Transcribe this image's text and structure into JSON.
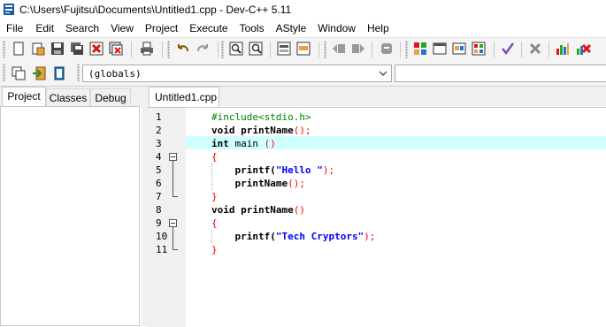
{
  "window": {
    "title": "C:\\Users\\Fujitsu\\Documents\\Untitled1.cpp - Dev-C++ 5.11"
  },
  "menu": [
    "File",
    "Edit",
    "Search",
    "View",
    "Project",
    "Execute",
    "Tools",
    "AStyle",
    "Window",
    "Help"
  ],
  "toolbar": {
    "icons": [
      "new-file-icon",
      "open-project-icon",
      "save-icon",
      "save-all-icon",
      "close-icon",
      "close-all-icon",
      "print-icon",
      "undo-icon",
      "redo-icon",
      "find-icon",
      "replace-icon",
      "goto-icon",
      "bookmark-icon",
      "indent-icon",
      "unindent-icon",
      "compile-icon",
      "run-icon",
      "compile-run-icon",
      "rebuild-icon",
      "debug-icon",
      "stop-icon",
      "profile-icon",
      "delete-profile-icon",
      "new-class-icon",
      "insert-icon",
      "toggle-icon"
    ],
    "scope_select": "(globals)"
  },
  "left_panel": {
    "tabs": [
      "Project",
      "Classes",
      "Debug"
    ],
    "active_tab": "Project"
  },
  "editor": {
    "file_tab": "Untitled1.cpp",
    "highlighted_line": 3,
    "line_numbers": [
      "1",
      "2",
      "3",
      "4",
      "5",
      "6",
      "7",
      "8",
      "9",
      "10",
      "11"
    ],
    "code": {
      "l1_directive": "#include<stdio.h>",
      "l2_type": "void",
      "l2_name": " printName",
      "l2_parens": "();",
      "l3_type": "int",
      "l3_name": " main ",
      "l3_parens": "()",
      "l4": "{",
      "l5_call": "    printf(",
      "l5_string": "\"Hello \"",
      "l5_end": ");",
      "l6_call": "    printName",
      "l6_end": "();",
      "l7": "}",
      "l8_type": "void",
      "l8_name": " printName",
      "l8_parens": "()",
      "l9": "{",
      "l10_call": "    printf(",
      "l10_string": "\"Tech Cryptors\"",
      "l10_end": ");",
      "l11": "}"
    }
  }
}
